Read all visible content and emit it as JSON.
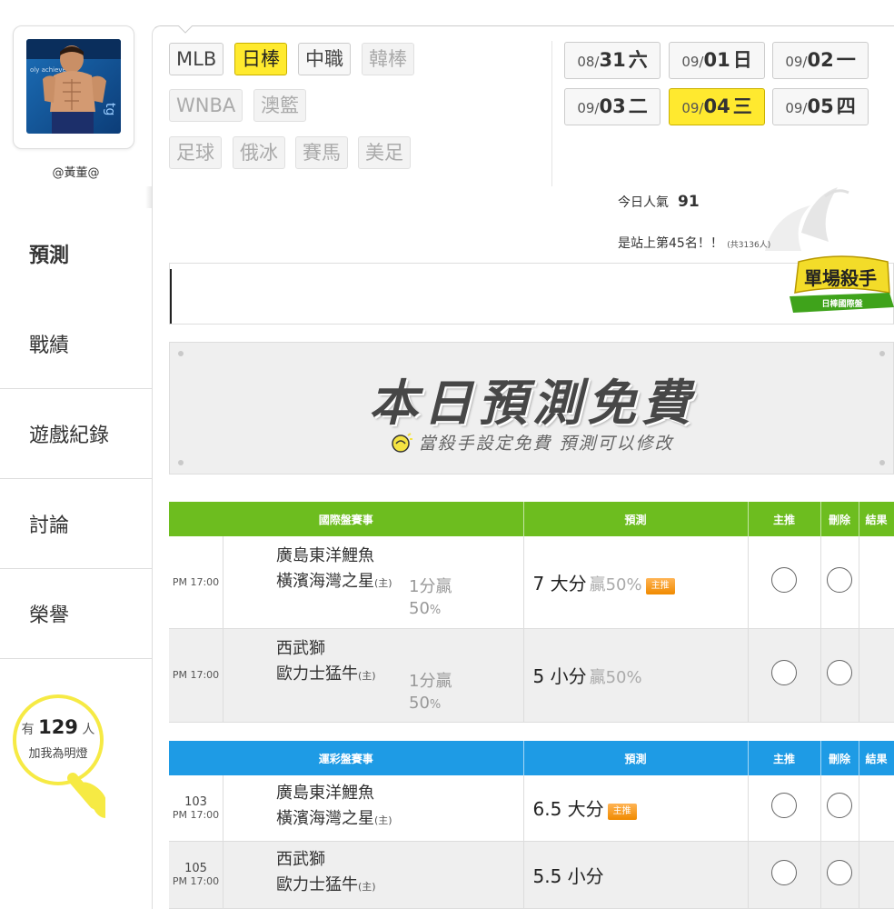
{
  "user": {
    "name": "@黃董@"
  },
  "sidebar": {
    "items": [
      {
        "label": "預測",
        "active": true
      },
      {
        "label": "戰績"
      },
      {
        "label": "遊戲紀錄"
      },
      {
        "label": "討論"
      },
      {
        "label": "榮譽"
      }
    ],
    "lamp": {
      "prefix": "有",
      "count": "129",
      "suffix": "人",
      "sub": "加我為明燈"
    }
  },
  "sports": [
    {
      "label": "MLB",
      "state": "normal"
    },
    {
      "label": "日棒",
      "state": "selected"
    },
    {
      "label": "中職",
      "state": "normal"
    },
    {
      "label": "韓棒",
      "state": "disabled"
    },
    {
      "label": "WNBA",
      "state": "disabled"
    },
    {
      "label": "澳籃",
      "state": "disabled"
    },
    {
      "label": "足球",
      "state": "disabled"
    },
    {
      "label": "俄冰",
      "state": "disabled"
    },
    {
      "label": "賽馬",
      "state": "disabled"
    },
    {
      "label": "美足",
      "state": "disabled"
    }
  ],
  "dates": [
    {
      "md": "08/",
      "d": "31",
      "wd": "六"
    },
    {
      "md": "09/",
      "d": "01",
      "wd": "日"
    },
    {
      "md": "09/",
      "d": "02",
      "wd": "一"
    },
    {
      "md": "09/",
      "d": "03",
      "wd": "二"
    },
    {
      "md": "09/",
      "d": "04",
      "wd": "三",
      "selected": true
    },
    {
      "md": "09/",
      "d": "05",
      "wd": "四"
    }
  ],
  "stats": {
    "popularity_label": "今日人氣",
    "popularity_value": "91",
    "rank_text": "是站上第45名！！",
    "rank_note": "(共3136人)"
  },
  "badge": {
    "title": "單場殺手",
    "subtitle": "日棒國際盤"
  },
  "banner": {
    "title": "本日預測免費",
    "subtitle": "當殺手設定免費 預測可以修改"
  },
  "intl_table": {
    "headers": [
      "國際盤賽事",
      "預測",
      "主推",
      "刪除",
      "結果"
    ],
    "rows": [
      {
        "time": "PM 17:00",
        "away": "廣島東洋鯉魚",
        "home": "橫濱海灣之星",
        "home_mark": "(主)",
        "handicap": "1分贏",
        "handicap_pct": "50",
        "pct_unit": "%",
        "prediction": "7 大分",
        "win": "贏50%",
        "main_pick": "主推"
      },
      {
        "time": "PM 17:00",
        "away": "西武獅",
        "home": "歐力士猛牛",
        "home_mark": "(主)",
        "handicap": "1分贏",
        "handicap_pct": "50",
        "pct_unit": "%",
        "prediction": "5 小分",
        "win": "贏50%"
      }
    ]
  },
  "lottery_table": {
    "headers": [
      "運彩盤賽事",
      "預測",
      "主推",
      "刪除",
      "結果"
    ],
    "rows": [
      {
        "no": "103",
        "time": "PM 17:00",
        "away": "廣島東洋鯉魚",
        "home": "橫濱海灣之星",
        "home_mark": "(主)",
        "prediction": "6.5 大分",
        "main_pick": "主推"
      },
      {
        "no": "105",
        "time": "PM 17:00",
        "away": "西武獅",
        "home": "歐力士猛牛",
        "home_mark": "(主)",
        "prediction": "5.5 小分"
      }
    ]
  },
  "colors": {
    "accent_yellow": "#ffea2e",
    "intl_header": "#6dbd1f",
    "lottery_header": "#1e9be5",
    "badge_orange": "#f08a00"
  }
}
